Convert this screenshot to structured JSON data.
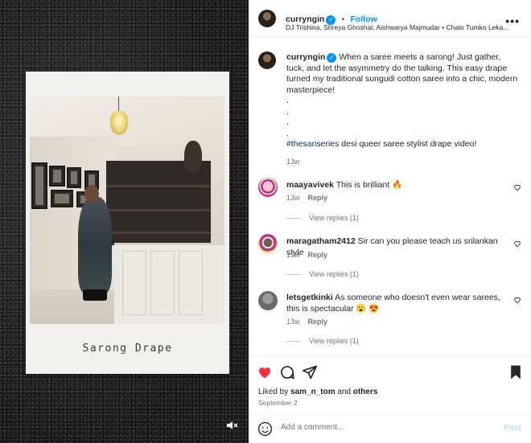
{
  "media": {
    "caption": "Sarong Drape"
  },
  "header": {
    "username": "curryngin",
    "follow_label": "Follow",
    "separator": "•",
    "audio_credits": "DJ Trishina, Shreya Ghoshal, Aishwarya Majmudar • Chalo Tumko Leka...",
    "more": "•••"
  },
  "post": {
    "username": "curryngin",
    "caption_line": "When a saree meets a sarong! Just gather, tuck, and let the asymmetry do the talking. This easy drape turned my traditional sungudi cotton saree into a chic, modern masterpiece!",
    "dots": [
      ".",
      ".",
      ".",
      "."
    ],
    "hashtag": "#thesariseries",
    "caption_tail": " desi queer saree stylist drape video!",
    "time": "13w"
  },
  "comments": [
    {
      "username": "maayavivek",
      "text": "This is brilliant 🔥",
      "time": "13w",
      "reply_label": "Reply",
      "view_replies": "View replies (1)"
    },
    {
      "username": "maragatham2412",
      "text": "Sir can you please teach us srilankan style",
      "time": "13w",
      "reply_label": "Reply",
      "view_replies": "View replies (1)"
    },
    {
      "username": "letsgetkinki",
      "text": "As someone who doesn't even wear sarees, this is spectacular 😮 😍",
      "time": "13w",
      "reply_label": "Reply",
      "view_replies": "View replies (1)"
    }
  ],
  "likes": {
    "prefix": "Liked by ",
    "user": "sam_n_tom",
    "middle": " and ",
    "others": "others",
    "date": "September 2"
  },
  "comment_box": {
    "placeholder": "Add a comment...",
    "post_label": "Post"
  },
  "colors": {
    "accent": "#0095f6",
    "like_red": "#ff3040",
    "hashtag": "#00376b"
  }
}
